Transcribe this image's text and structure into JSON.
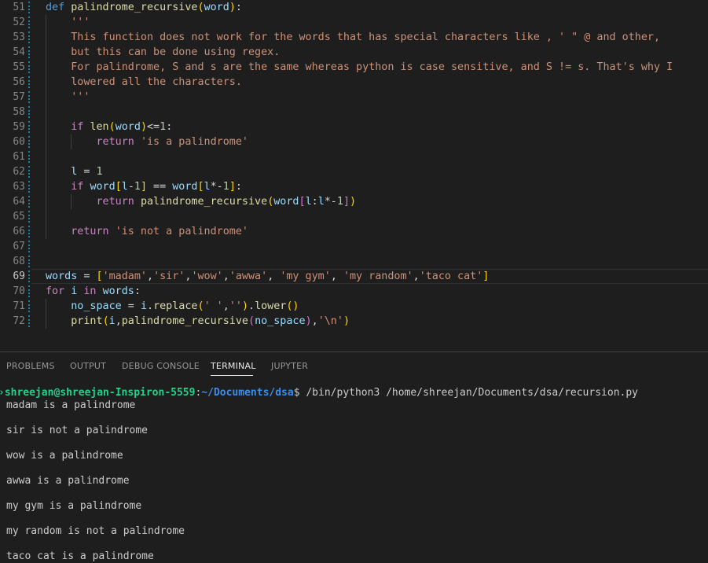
{
  "editor": {
    "lines": [
      {
        "n": "51",
        "segs": [
          [
            "kw",
            "def"
          ],
          [
            "op",
            " "
          ],
          [
            "fn",
            "palindrome_recursive"
          ],
          [
            "br1",
            "("
          ],
          [
            "var",
            "word"
          ],
          [
            "br1",
            ")"
          ],
          [
            "op",
            ":"
          ]
        ]
      },
      {
        "n": "52",
        "segs": [
          [
            "op",
            "    "
          ],
          [
            "str",
            "'''"
          ]
        ]
      },
      {
        "n": "53",
        "segs": [
          [
            "op",
            "    "
          ],
          [
            "str",
            "This function does not work for the words that has special characters like , ' \" @ and other,"
          ]
        ]
      },
      {
        "n": "54",
        "segs": [
          [
            "op",
            "    "
          ],
          [
            "str",
            "but this can be done using regex."
          ]
        ]
      },
      {
        "n": "55",
        "segs": [
          [
            "op",
            "    "
          ],
          [
            "str",
            "For palindrome, S and s are the same whereas python is case sensitive, and S != s. That's why I"
          ]
        ]
      },
      {
        "n": "56",
        "segs": [
          [
            "op",
            "    "
          ],
          [
            "str",
            "lowered all the characters."
          ]
        ]
      },
      {
        "n": "57",
        "segs": [
          [
            "op",
            "    "
          ],
          [
            "str",
            "'''"
          ]
        ]
      },
      {
        "n": "58",
        "segs": []
      },
      {
        "n": "59",
        "segs": [
          [
            "op",
            "    "
          ],
          [
            "ctl",
            "if"
          ],
          [
            "op",
            " "
          ],
          [
            "fn",
            "len"
          ],
          [
            "br1",
            "("
          ],
          [
            "var",
            "word"
          ],
          [
            "br1",
            ")"
          ],
          [
            "op",
            "<="
          ],
          [
            "num",
            "1"
          ],
          [
            "op",
            ":"
          ]
        ]
      },
      {
        "n": "60",
        "segs": [
          [
            "op",
            "        "
          ],
          [
            "ctl",
            "return"
          ],
          [
            "op",
            " "
          ],
          [
            "str",
            "'is a palindrome'"
          ]
        ]
      },
      {
        "n": "61",
        "segs": []
      },
      {
        "n": "62",
        "segs": [
          [
            "op",
            "    "
          ],
          [
            "var",
            "l"
          ],
          [
            "op",
            " = "
          ],
          [
            "num",
            "1"
          ]
        ]
      },
      {
        "n": "63",
        "segs": [
          [
            "op",
            "    "
          ],
          [
            "ctl",
            "if"
          ],
          [
            "op",
            " "
          ],
          [
            "var",
            "word"
          ],
          [
            "br1",
            "["
          ],
          [
            "var",
            "l"
          ],
          [
            "op",
            "-"
          ],
          [
            "num",
            "1"
          ],
          [
            "br1",
            "]"
          ],
          [
            "op",
            " == "
          ],
          [
            "var",
            "word"
          ],
          [
            "br1",
            "["
          ],
          [
            "var",
            "l"
          ],
          [
            "op",
            "*-"
          ],
          [
            "num",
            "1"
          ],
          [
            "br1",
            "]"
          ],
          [
            "op",
            ":"
          ]
        ]
      },
      {
        "n": "64",
        "segs": [
          [
            "op",
            "        "
          ],
          [
            "ctl",
            "return"
          ],
          [
            "op",
            " "
          ],
          [
            "fn",
            "palindrome_recursive"
          ],
          [
            "br1",
            "("
          ],
          [
            "var",
            "word"
          ],
          [
            "br2",
            "["
          ],
          [
            "var",
            "l"
          ],
          [
            "op",
            ":"
          ],
          [
            "var",
            "l"
          ],
          [
            "op",
            "*-"
          ],
          [
            "num",
            "1"
          ],
          [
            "br2",
            "]"
          ],
          [
            "br1",
            ")"
          ]
        ]
      },
      {
        "n": "65",
        "segs": []
      },
      {
        "n": "66",
        "segs": [
          [
            "op",
            "    "
          ],
          [
            "ctl",
            "return"
          ],
          [
            "op",
            " "
          ],
          [
            "str",
            "'is not a palindrome'"
          ]
        ]
      },
      {
        "n": "67",
        "segs": []
      },
      {
        "n": "68",
        "segs": []
      },
      {
        "n": "69",
        "segs": [
          [
            "var",
            "words"
          ],
          [
            "op",
            " = "
          ],
          [
            "br1",
            "["
          ],
          [
            "str",
            "'madam'"
          ],
          [
            "op",
            ","
          ],
          [
            "str",
            "'sir'"
          ],
          [
            "op",
            ","
          ],
          [
            "str",
            "'wow'"
          ],
          [
            "op",
            ","
          ],
          [
            "str",
            "'awwa'"
          ],
          [
            "op",
            ", "
          ],
          [
            "str",
            "'my gym'"
          ],
          [
            "op",
            ", "
          ],
          [
            "str",
            "'my random'"
          ],
          [
            "op",
            ","
          ],
          [
            "str",
            "'taco cat'"
          ],
          [
            "br1",
            "]"
          ]
        ]
      },
      {
        "n": "70",
        "segs": [
          [
            "ctl",
            "for"
          ],
          [
            "op",
            " "
          ],
          [
            "var",
            "i"
          ],
          [
            "op",
            " "
          ],
          [
            "ctl",
            "in"
          ],
          [
            "op",
            " "
          ],
          [
            "var",
            "words"
          ],
          [
            "op",
            ":"
          ]
        ]
      },
      {
        "n": "71",
        "segs": [
          [
            "op",
            "    "
          ],
          [
            "var",
            "no_space"
          ],
          [
            "op",
            " = "
          ],
          [
            "var",
            "i"
          ],
          [
            "op",
            "."
          ],
          [
            "fn",
            "replace"
          ],
          [
            "br1",
            "("
          ],
          [
            "str",
            "' '"
          ],
          [
            "op",
            ","
          ],
          [
            "str",
            "''"
          ],
          [
            "br1",
            ")"
          ],
          [
            "op",
            "."
          ],
          [
            "fn",
            "lower"
          ],
          [
            "br1",
            "()"
          ]
        ]
      },
      {
        "n": "72",
        "segs": [
          [
            "op",
            "    "
          ],
          [
            "fn",
            "print"
          ],
          [
            "br1",
            "("
          ],
          [
            "var",
            "i"
          ],
          [
            "op",
            ","
          ],
          [
            "fn",
            "palindrome_recursive"
          ],
          [
            "br2",
            "("
          ],
          [
            "var",
            "no_space"
          ],
          [
            "br2",
            ")"
          ],
          [
            "op",
            ","
          ],
          [
            "str",
            "'\\n'"
          ],
          [
            "br1",
            ")"
          ]
        ]
      }
    ]
  },
  "panel": {
    "tabs": [
      {
        "label": "PROBLEMS",
        "active": false
      },
      {
        "label": "OUTPUT",
        "active": false
      },
      {
        "label": "DEBUG CONSOLE",
        "active": false
      },
      {
        "label": "TERMINAL",
        "active": true
      },
      {
        "label": "JUPYTER",
        "active": false
      }
    ]
  },
  "terminal": {
    "prompt": {
      "user_host": "shreejan@shreejan-Inspiron-5559",
      "colon": ":",
      "path": "~/Documents/dsa",
      "dollar": "$",
      "command": " /bin/python3 /home/shreejan/Documents/dsa/recursion.py"
    },
    "output": [
      "madam is a palindrome",
      "",
      "sir is not a palindrome",
      "",
      "wow is a palindrome",
      "",
      "awwa is a palindrome",
      "",
      "my gym is a palindrome",
      "",
      "my random is not a palindrome",
      "",
      "taco cat is a palindrome"
    ]
  },
  "colors": {
    "background": "#1e1e1e",
    "keyword": "#569cd6",
    "control": "#c586c0",
    "function": "#dcdcaa",
    "variable": "#9cdcfe",
    "string": "#ce9178",
    "number": "#b5cea8",
    "prompt_green": "#23d18b",
    "prompt_blue": "#3b8eea"
  }
}
